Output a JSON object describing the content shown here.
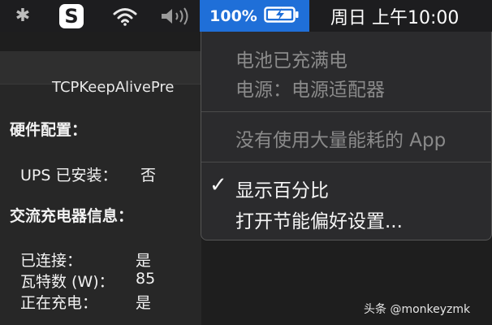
{
  "menubar": {
    "bluetooth_icon": "bluetooth-icon",
    "app_icon_letter": "S",
    "wifi_icon": "wifi-icon",
    "volume_icon": "volume-icon",
    "battery_percent": "100%",
    "battery_icon": "battery-charging-icon",
    "clock": "周日 上午10:00"
  },
  "window": {
    "title": "TCPKeepAlivePre",
    "hardware_heading": "硬件配置：",
    "ups_label": "UPS 已安装：",
    "ups_value": "否",
    "ac_heading": "交流充电器信息：",
    "rows": [
      {
        "label": "已连接：",
        "value": "是"
      },
      {
        "label": "瓦特数 (W)：",
        "value": "85"
      },
      {
        "label": "正在充电：",
        "value": "是"
      }
    ]
  },
  "battery_menu": {
    "status": "电池已充满电",
    "power_source": "电源：电源适配器",
    "no_heavy_apps": "没有使用大量能耗的 App",
    "check_mark": "✓",
    "show_percentage": "显示百分比",
    "open_energy_prefs": "打开节能偏好设置..."
  },
  "watermark": "头条 @monkeyzmk",
  "colors": {
    "menubar_bg": "#1d1d1f",
    "battery_highlight": "#1f6fd8",
    "menu_bg": "#2b2b2d"
  }
}
